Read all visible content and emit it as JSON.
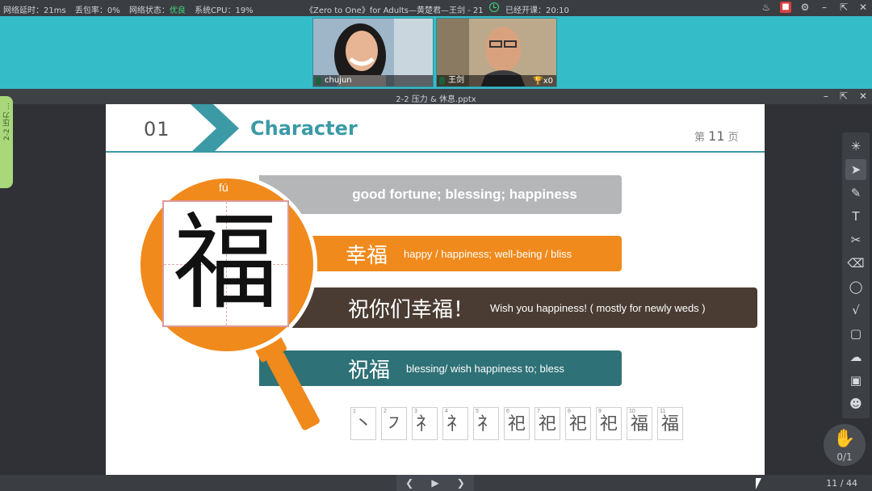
{
  "status_bar": {
    "latency": "网络延时：21ms",
    "packet_loss": "丢包率：0%",
    "network_label": "网络状态：",
    "network_value": "优良",
    "cpu": "系统CPU：19%",
    "class_title": "《Zero to One》for Adults—黄楚君—王剑 - 21",
    "started": "已经开课：20:10",
    "accent_good": "#3fd87a"
  },
  "videos": [
    {
      "name": "chujun"
    },
    {
      "name": "王剑",
      "trophy_count": "x0"
    }
  ],
  "document": {
    "title": "2-2 压力 & 休息.pptx",
    "side_tab": "2-2 压力 ..."
  },
  "slide": {
    "number": "01",
    "title": "Character",
    "page_prefix": "第",
    "page_number": "11",
    "page_suffix": "页",
    "pinyin": "fú",
    "character": "福",
    "definition": "good fortune; blessing; happiness",
    "phrases": [
      {
        "zh": "幸福",
        "en": "happy / happiness; well-being / bliss",
        "color": "#f08a1c"
      },
      {
        "zh": "祝你们幸福！",
        "en": "Wish you happiness! ( mostly for newly weds )",
        "color": "#4a3c33"
      },
      {
        "zh": "祝福",
        "en": "blessing/ wish happiness to; bless",
        "color": "#2e7176"
      }
    ],
    "stroke_order": [
      {
        "n": "1",
        "g": "丶"
      },
      {
        "n": "2",
        "g": "㇇"
      },
      {
        "n": "3",
        "g": "礻"
      },
      {
        "n": "4",
        "g": "礻"
      },
      {
        "n": "5",
        "g": "礻"
      },
      {
        "n": "6",
        "g": "祀"
      },
      {
        "n": "7",
        "g": "祀"
      },
      {
        "n": "8",
        "g": "祀"
      },
      {
        "n": "9",
        "g": "祀"
      },
      {
        "n": "10",
        "g": "福"
      },
      {
        "n": "11",
        "g": "福"
      }
    ]
  },
  "toolbar": {
    "tools": [
      "laser-pointer-icon",
      "select-move-icon",
      "pen-icon",
      "text-icon",
      "scissors-icon",
      "trash-icon",
      "shape-icon",
      "formula-icon",
      "chat-bubble-icon",
      "cloud-icon",
      "toolbox-icon",
      "users-icon"
    ]
  },
  "raise_hand": {
    "count": "0/1"
  },
  "pager": {
    "label": "11 / 44"
  }
}
